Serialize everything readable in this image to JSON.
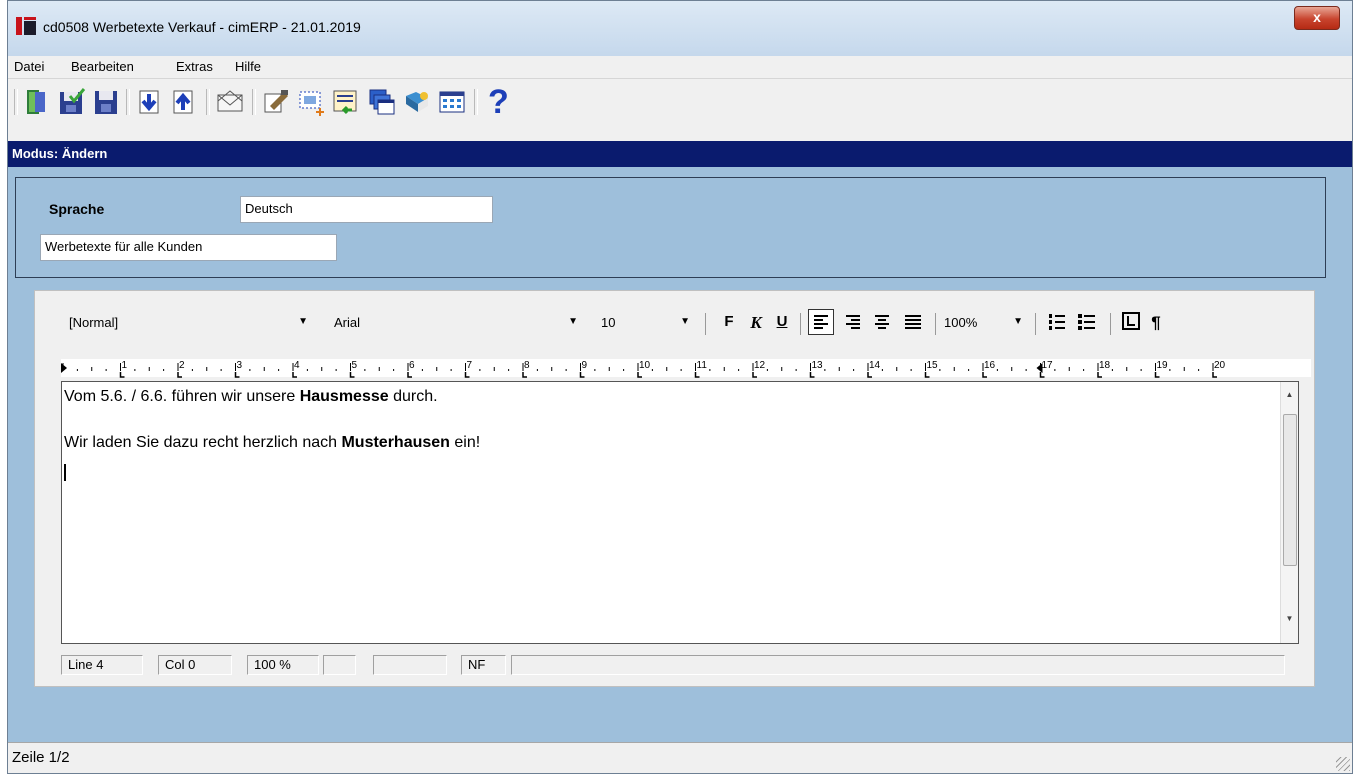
{
  "window": {
    "title": "cd0508 Werbetexte Verkauf - cimERP - 21.01.2019",
    "close_label": "x"
  },
  "menu": [
    {
      "label": "Datei"
    },
    {
      "label": "Bearbeiten"
    },
    {
      "label": "Extras"
    },
    {
      "label": "Hilfe"
    }
  ],
  "toolbar": {
    "buttons": [
      "exit-icon",
      "save-check-icon",
      "save-icon",
      "download-icon",
      "upload-icon",
      "mail-icon",
      "edit-icon",
      "select-icon",
      "transfer-icon",
      "windows-icon",
      "book-icon",
      "grid-icon",
      "help-icon"
    ]
  },
  "mode": {
    "label": "Modus: Ändern"
  },
  "form": {
    "sprache_label": "Sprache",
    "sprache_value": "Deutsch",
    "description_value": "Werbetexte für alle Kunden"
  },
  "format_bar": {
    "style": "[Normal]",
    "font": "Arial",
    "size": "10",
    "bold": "F",
    "italic": "K",
    "underline": "U",
    "zoom": "100%"
  },
  "ruler": {
    "labels": [
      "1",
      "2",
      "3",
      "4",
      "5",
      "6",
      "7",
      "8",
      "9",
      "10",
      "11",
      "12",
      "13",
      "14",
      "15",
      "16",
      "17",
      "18",
      "19",
      "20"
    ]
  },
  "editor": {
    "line1_pre": "Vom 5.6. / 6.6. führen wir unsere ",
    "line1_bold": "Hausmesse",
    "line1_post": " durch.",
    "line2_pre": "Wir laden Sie dazu recht herzlich nach ",
    "line2_bold": "Musterhausen",
    "line2_post": " ein!"
  },
  "editor_status": {
    "line": "Line  4",
    "col": "Col  0",
    "zoom": "100 %",
    "nf": "NF"
  },
  "statusbar": {
    "text": "Zeile 1/2"
  }
}
